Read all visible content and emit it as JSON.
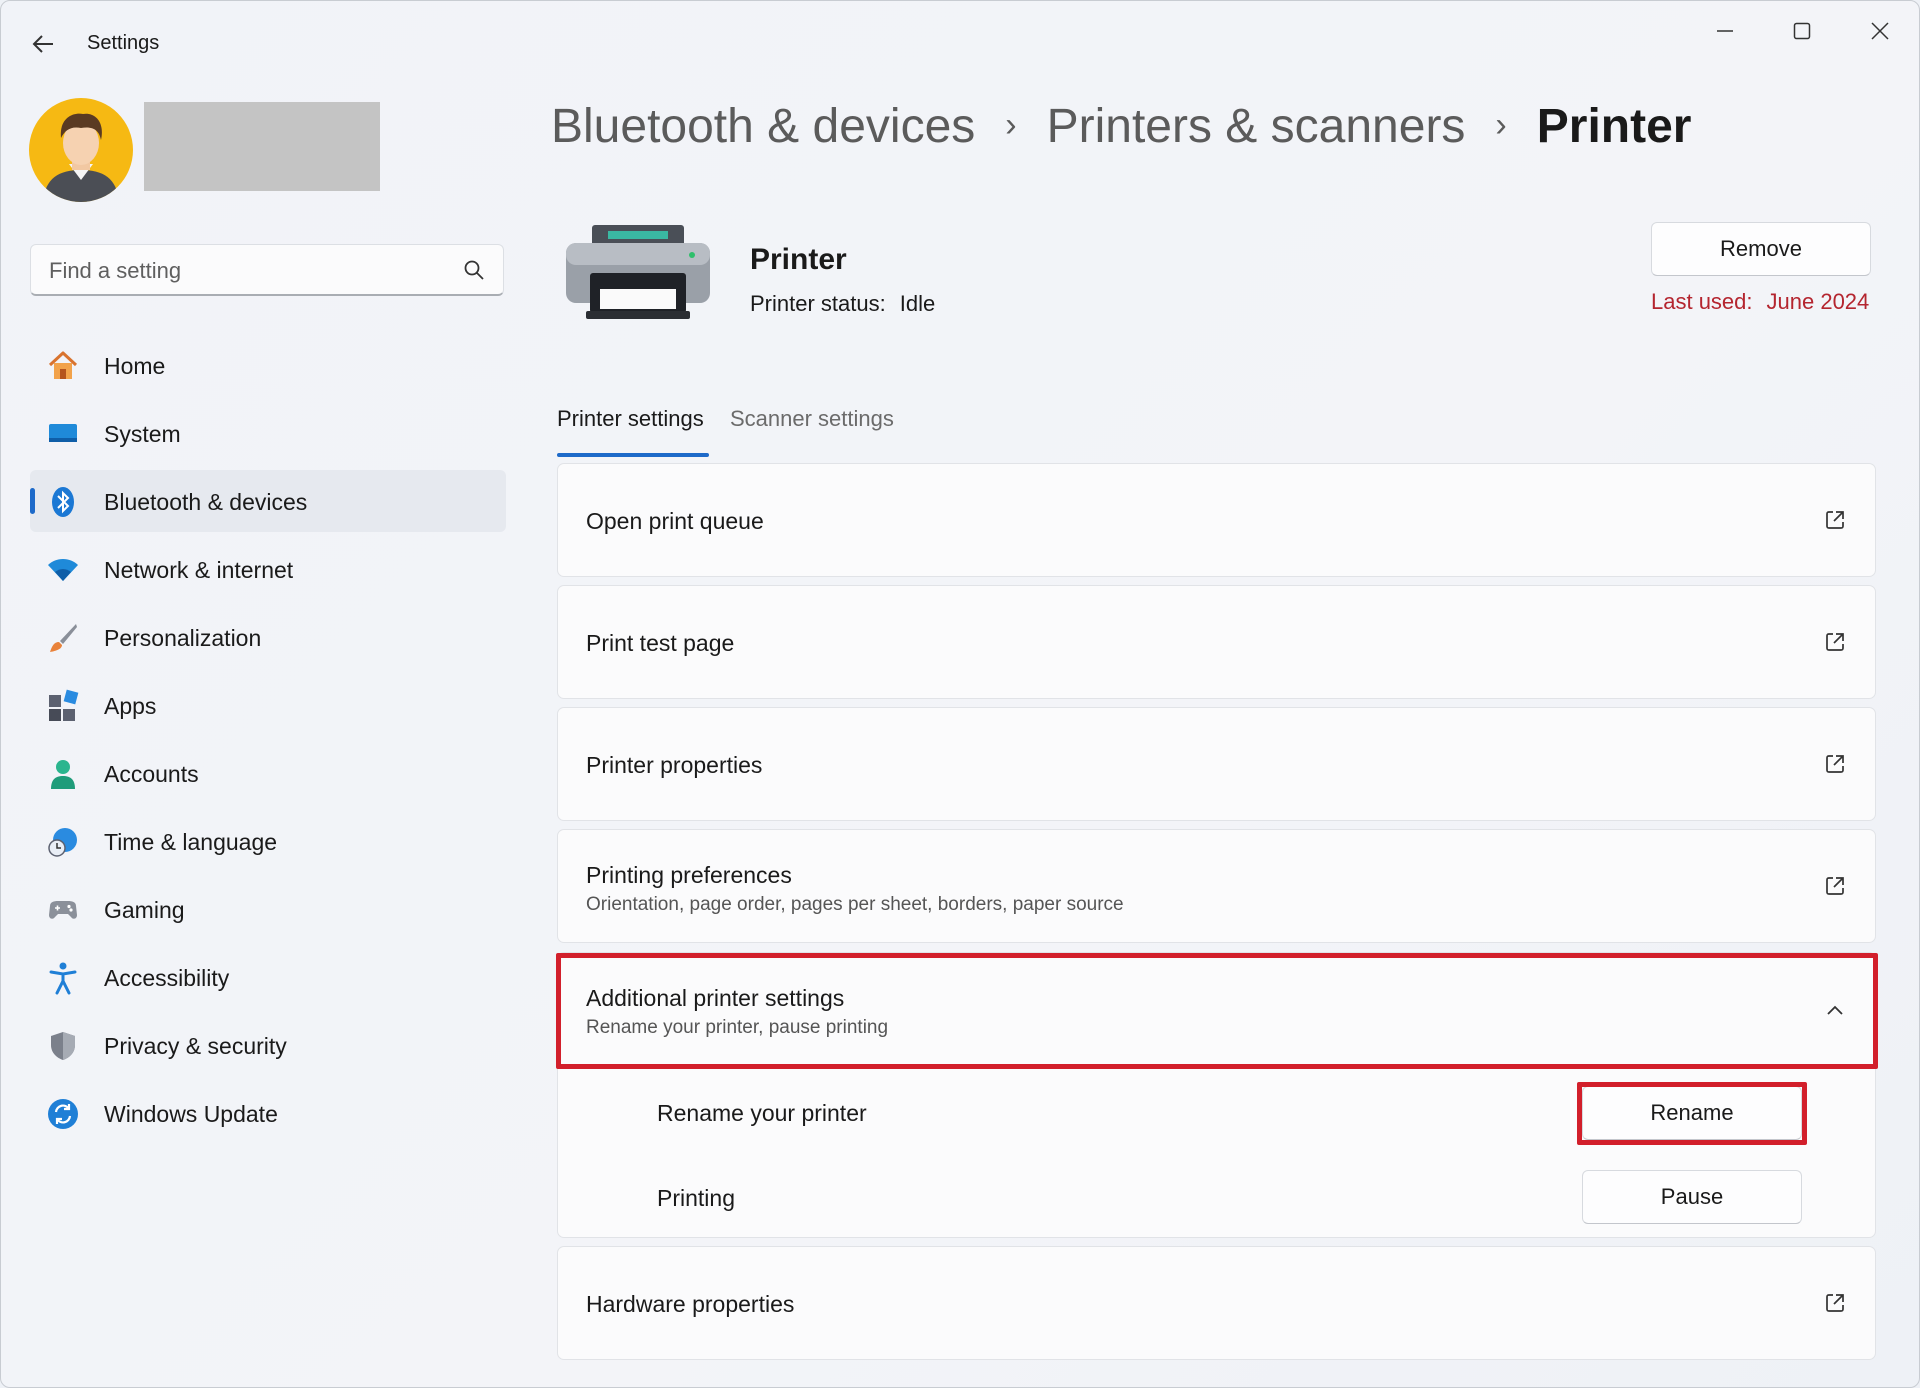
{
  "window": {
    "title": "Settings"
  },
  "sidebar": {
    "search_placeholder": "Find a setting",
    "items": [
      {
        "label": "Home",
        "icon": "home-icon"
      },
      {
        "label": "System",
        "icon": "system-icon"
      },
      {
        "label": "Bluetooth & devices",
        "icon": "bluetooth-icon",
        "active": true
      },
      {
        "label": "Network & internet",
        "icon": "wifi-icon"
      },
      {
        "label": "Personalization",
        "icon": "brush-icon"
      },
      {
        "label": "Apps",
        "icon": "apps-icon"
      },
      {
        "label": "Accounts",
        "icon": "person-icon"
      },
      {
        "label": "Time & language",
        "icon": "globe-clock-icon"
      },
      {
        "label": "Gaming",
        "icon": "gamepad-icon"
      },
      {
        "label": "Accessibility",
        "icon": "accessibility-icon"
      },
      {
        "label": "Privacy & security",
        "icon": "shield-icon"
      },
      {
        "label": "Windows Update",
        "icon": "sync-icon"
      }
    ]
  },
  "breadcrumb": {
    "level1": "Bluetooth & devices",
    "level2": "Printers & scanners",
    "current": "Printer",
    "separator": "›"
  },
  "printer": {
    "name": "Printer",
    "status_label": "Printer status:",
    "status_value": "Idle",
    "remove_label": "Remove",
    "last_used_label": "Last used:",
    "last_used_value": "June 2024"
  },
  "tabs": [
    "Printer settings",
    "Scanner settings"
  ],
  "settings": {
    "open_print_queue": "Open print queue",
    "print_test_page": "Print test page",
    "printer_properties": "Printer properties",
    "printing_preferences": {
      "title": "Printing preferences",
      "subtitle": "Orientation, page order, pages per sheet, borders, paper source"
    },
    "additional": {
      "title": "Additional printer settings",
      "subtitle": "Rename your printer, pause printing",
      "rename_label": "Rename your printer",
      "rename_button": "Rename",
      "printing_label": "Printing",
      "pause_button": "Pause"
    },
    "hardware_properties": "Hardware properties"
  },
  "colors": {
    "accent": "#1e6ac9",
    "highlight": "#d21f2b",
    "last_used": "#b4252f"
  }
}
